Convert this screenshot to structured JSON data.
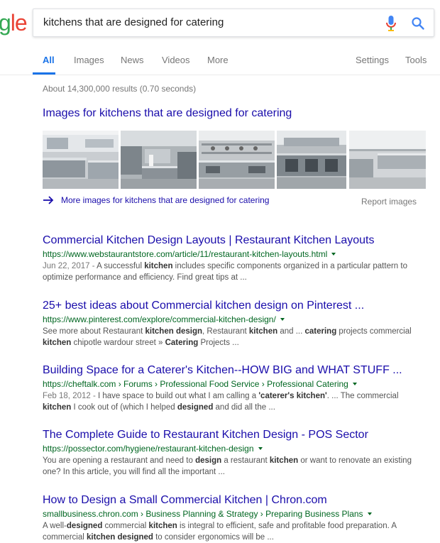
{
  "logo": {
    "part1": "g",
    "part2": "le"
  },
  "search": {
    "query": "kitchens that are designed for catering"
  },
  "tabs": [
    {
      "label": "All"
    },
    {
      "label": "Images"
    },
    {
      "label": "News"
    },
    {
      "label": "Videos"
    },
    {
      "label": "More"
    }
  ],
  "tools": {
    "settings": "Settings",
    "tools": "Tools"
  },
  "stats": "About 14,300,000 results (0.70 seconds)",
  "images_block": {
    "heading": "Images for kitchens that are designed for catering",
    "more_link": "More images for kitchens that are designed for catering",
    "report": "Report images"
  },
  "results": [
    {
      "title": "Commercial Kitchen Design Layouts | Restaurant Kitchen Layouts",
      "url": "https://www.webstaurantstore.com/article/11/restaurant-kitchen-layouts.html",
      "date": "Jun 22, 2017 - ",
      "s": [
        "A successful ",
        "kitchen",
        " includes specific components organized in a particular pattern to optimize performance and efficiency. Find great tips at ..."
      ]
    },
    {
      "title": "25+ best ideas about Commercial kitchen design on Pinterest ...",
      "url": "https://www.pinterest.com/explore/commercial-kitchen-design/",
      "date": "",
      "s": [
        "See more about Restaurant ",
        "kitchen design",
        ", Restaurant ",
        "kitchen",
        " and ... ",
        "catering",
        " projects commercial ",
        "kitchen",
        " chipotle wardour street » ",
        "Catering",
        " Projects ..."
      ]
    },
    {
      "title": "Building Space for a Caterer's Kitchen--HOW BIG and WHAT STUFF ...",
      "url": "https://cheftalk.com › Forums › Professional Food Service › Professional Catering",
      "date": "Feb 18, 2012 - ",
      "s": [
        "I have space to build out what I am calling a ",
        "'caterer's kitchen'",
        ". ... The commercial ",
        "kitchen",
        " I cook out of (which I helped ",
        "designed",
        " and did all the ..."
      ]
    },
    {
      "title": "The Complete Guide to Restaurant Kitchen Design - POS Sector",
      "url": "https://possector.com/hygiene/restaurant-kitchen-design",
      "date": "",
      "s": [
        "You are opening a restaurant and need to ",
        "design",
        " a restaurant ",
        "kitchen",
        " or want to renovate an existing one? In this article, you will find all the important ..."
      ]
    },
    {
      "title": "How to Design a Small Commercial Kitchen | Chron.com",
      "url": "smallbusiness.chron.com › Business Planning & Strategy › Preparing Business Plans",
      "date": "",
      "s": [
        "A well-",
        "designed",
        " commercial ",
        "kitchen",
        " is integral to efficient, safe and profitable food preparation. A commercial ",
        "kitchen designed",
        " to consider ergonomics will be ..."
      ]
    }
  ]
}
